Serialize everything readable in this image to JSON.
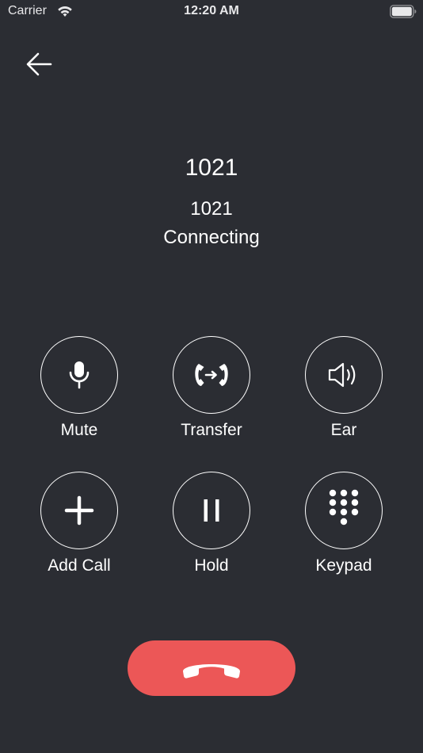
{
  "status_bar": {
    "carrier": "Carrier",
    "time": "12:20 AM",
    "wifi_icon": "wifi-icon",
    "battery_icon": "battery-icon"
  },
  "call": {
    "name": "1021",
    "number": "1021",
    "status": "Connecting"
  },
  "actions": {
    "mute": {
      "label": "Mute",
      "icon": "microphone-icon"
    },
    "transfer": {
      "label": "Transfer",
      "icon": "transfer-icon"
    },
    "ear": {
      "label": "Ear",
      "icon": "speaker-icon"
    },
    "add_call": {
      "label": "Add Call",
      "icon": "plus-icon"
    },
    "hold": {
      "label": "Hold",
      "icon": "pause-icon"
    },
    "keypad": {
      "label": "Keypad",
      "icon": "keypad-icon"
    }
  },
  "colors": {
    "background": "#2b2d33",
    "end_call": "#ec5757",
    "foreground": "#ffffff"
  }
}
